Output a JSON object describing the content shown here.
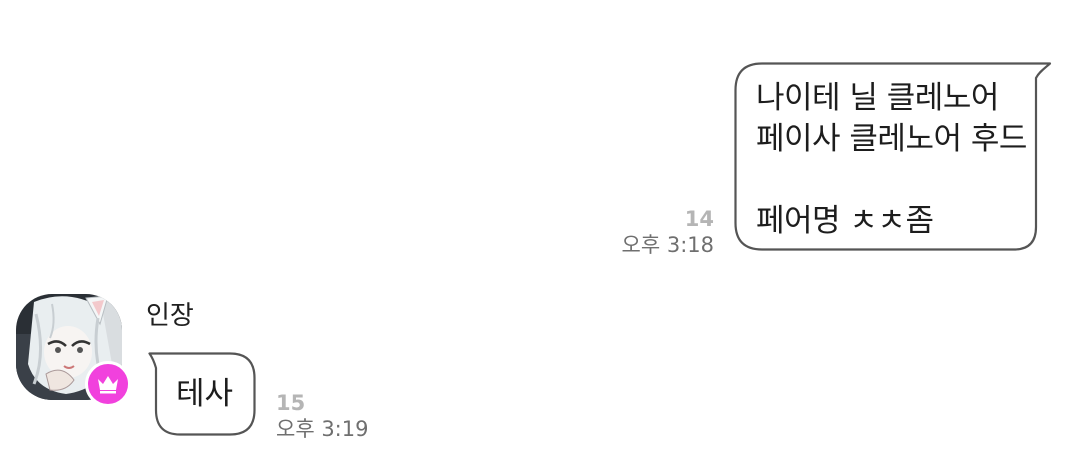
{
  "conversation": {
    "outgoing": {
      "text": "나이테 닐 클레노어\n페이사 클레노어 후드\n\n페어명 ㅊㅊ좀",
      "read_count": "14",
      "time": "오후 3:18"
    },
    "incoming": {
      "sender": "인장",
      "text": "테사",
      "read_count": "15",
      "time": "오후 3:19",
      "avatar_icon": "anime-character-avatar",
      "badge_icon": "crown-icon",
      "badge_color": "#f141dd"
    }
  }
}
